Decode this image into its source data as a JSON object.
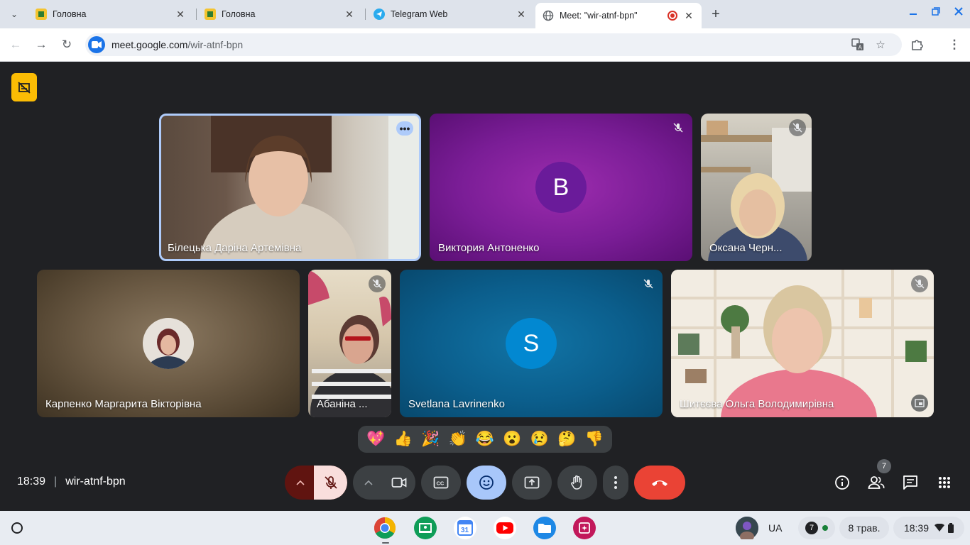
{
  "browser": {
    "tabs": [
      {
        "title": "Головна",
        "active": false
      },
      {
        "title": "Головна",
        "active": false
      },
      {
        "title": "Telegram Web",
        "active": false
      },
      {
        "title": "Meet: \"wir-atnf-bpn\"",
        "active": true
      }
    ],
    "url": {
      "host": "meet.google.com",
      "path": "/wir-atnf-bpn"
    }
  },
  "meet": {
    "participants": [
      {
        "name": "Білецька Даріна Артемівна",
        "type": "video",
        "speaking": true
      },
      {
        "name": "Виктория Антоненко",
        "type": "avatar",
        "initial": "В",
        "muted": true
      },
      {
        "name": "Оксана Черн...",
        "type": "video",
        "muted": true
      },
      {
        "name": "Карпенко Маргарита Вікторівна",
        "type": "photo"
      },
      {
        "name": "Абаніна ...",
        "type": "video",
        "muted": true
      },
      {
        "name": "Svetlana Lavrinenko",
        "type": "avatar",
        "initial": "S",
        "muted": true
      },
      {
        "name": "Шитєєва Ольга Володимирівна",
        "type": "video",
        "muted": true
      }
    ],
    "reactions": [
      "💖",
      "👍",
      "🎉",
      "👏",
      "😂",
      "😮",
      "😢",
      "🤔",
      "👎"
    ],
    "time": "18:39",
    "meeting_code": "wir-atnf-bpn",
    "participant_count": "7"
  },
  "shelf": {
    "keyboard_layout": "UA",
    "notification_count": "7",
    "date": "8 трав.",
    "time": "18:39"
  },
  "colors": {
    "meet_bg": "#202124",
    "end_call": "#ea4335",
    "reactions_active": "#a8c7fa",
    "mic_muted_bg": "#f9dedc"
  }
}
